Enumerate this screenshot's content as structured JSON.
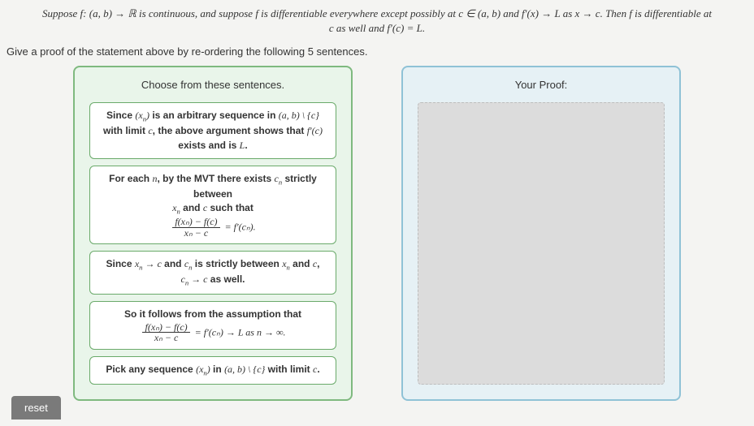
{
  "problem": {
    "line1": "Suppose f: (a, b) → ℝ is continuous, and suppose f is differentiable everywhere except possibly at c ∈ (a, b) and f′(x) → L as x → c. Then f is differentiable at",
    "line2": "c as well and f′(c) = L."
  },
  "instruction": "Give a proof of the statement above by re-ordering the following 5 sentences.",
  "source_panel": {
    "title": "Choose from these sentences.",
    "sentences": [
      {
        "pre": "Since ",
        "math1": "(xₙ)",
        "mid1": " is an arbitrary sequence in ",
        "math2": "(a, b) \\ {c}",
        "mid2": " with limit ",
        "math3": "c",
        "mid3": ", the above argument shows that ",
        "math4": "f′(c)",
        "post": " exists and is ",
        "math5": "L",
        "tail": "."
      },
      {
        "pre": "For each ",
        "math1": "n",
        "mid1": ", by the MVT there exists ",
        "math2": "cₙ",
        "mid2": " strictly between ",
        "math3": "xₙ",
        "mid3": " and ",
        "math4": "c",
        "mid4": " such that",
        "frac_num": "f(xₙ) − f(c)",
        "frac_den": "xₙ − c",
        "eq": " = f′(cₙ)."
      },
      {
        "pre": "Since ",
        "math1": "xₙ → c",
        "mid1": " and ",
        "math2": "cₙ",
        "mid2": " is strictly between ",
        "math3": "xₙ",
        "mid3": " and ",
        "math4": "c",
        "mid4": ", ",
        "math5": "cₙ → c",
        "post": " as well."
      },
      {
        "pre": "So it follows from the assumption that",
        "frac_num": "f(xₙ) − f(c)",
        "frac_den": "xₙ − c",
        "eq": " = f′(cₙ) → L as n → ∞."
      },
      {
        "pre": "Pick any sequence ",
        "math1": "(xₙ)",
        "mid1": " in ",
        "math2": "(a, b) \\ {c}",
        "mid2": " with limit ",
        "math3": "c",
        "post": "."
      }
    ]
  },
  "target_panel": {
    "title": "Your Proof:"
  },
  "reset_label": "reset"
}
